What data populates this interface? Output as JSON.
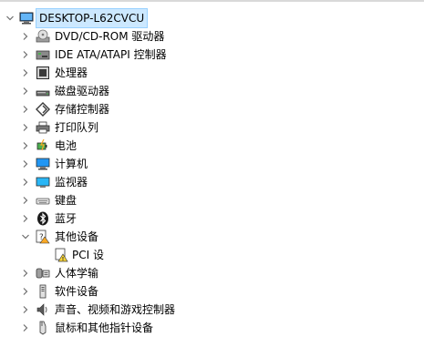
{
  "tree": {
    "root": {
      "label": "DESKTOP-L62CVCU",
      "icon": "computer-icon",
      "expanded": true
    },
    "items": [
      {
        "label": "DVD/CD-ROM 驱动器",
        "icon": "dvd-drive-icon",
        "expanded": false
      },
      {
        "label": "IDE ATA/ATAPI 控制器",
        "icon": "ide-controller-icon",
        "expanded": false
      },
      {
        "label": "处理器",
        "icon": "processor-icon",
        "expanded": false
      },
      {
        "label": "磁盘驱动器",
        "icon": "disk-drive-icon",
        "expanded": false
      },
      {
        "label": "存储控制器",
        "icon": "storage-controller-icon",
        "expanded": false
      },
      {
        "label": "打印队列",
        "icon": "printer-icon",
        "expanded": false
      },
      {
        "label": "电池",
        "icon": "battery-icon",
        "expanded": false
      },
      {
        "label": "计算机",
        "icon": "computer-monitor-icon",
        "expanded": false
      },
      {
        "label": "监视器",
        "icon": "monitor-icon",
        "expanded": false
      },
      {
        "label": "键盘",
        "icon": "keyboard-icon",
        "expanded": false
      },
      {
        "label": "蓝牙",
        "icon": "bluetooth-icon",
        "expanded": false
      },
      {
        "label": "其他设备",
        "icon": "other-devices-icon",
        "expanded": true,
        "children": [
          {
            "label": "PCI 设",
            "icon": "warning-device-icon"
          }
        ]
      },
      {
        "label": "人体学输",
        "icon": "hid-icon",
        "expanded": false
      },
      {
        "label": "软件设备",
        "icon": "software-device-icon",
        "expanded": false
      },
      {
        "label": "声音、视频和游戏控制器",
        "icon": "speaker-icon",
        "expanded": false
      },
      {
        "label": "鼠标和其他指针设备",
        "icon": "mouse-icon",
        "expanded": false
      }
    ]
  },
  "colors": {
    "selection_bg": "#cce8ff",
    "selection_border": "#99d1ff",
    "chevron": "#6d6d6d"
  }
}
